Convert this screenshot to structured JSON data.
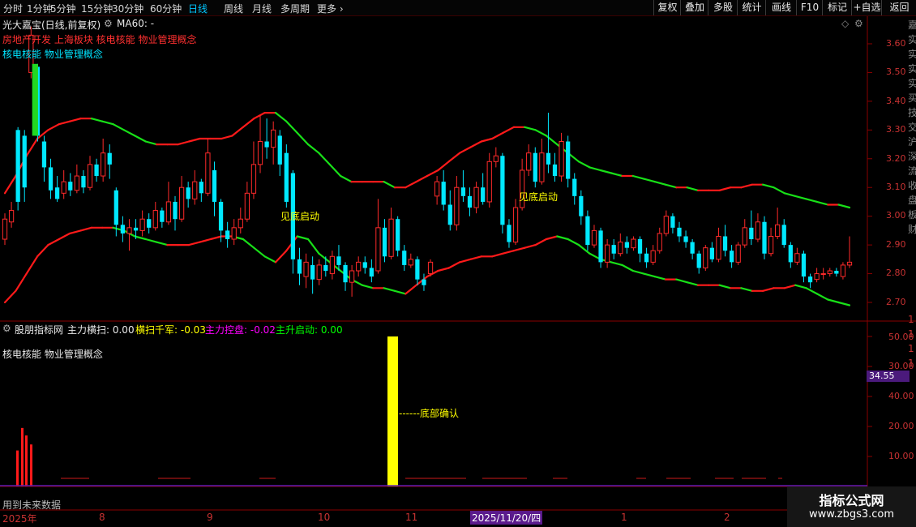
{
  "toolbar": {
    "periods": [
      {
        "label": "分时",
        "active": false
      },
      {
        "label": "1分钟",
        "active": false
      },
      {
        "label": "5分钟",
        "active": false
      },
      {
        "label": "15分钟",
        "active": false
      },
      {
        "label": "30分钟",
        "active": false
      },
      {
        "label": "60分钟",
        "active": false
      },
      {
        "label": "日线",
        "active": true
      },
      {
        "label": "周线",
        "active": false
      },
      {
        "label": "月线",
        "active": false
      },
      {
        "label": "多周期",
        "active": false
      },
      {
        "label": "更多",
        "active": false
      }
    ],
    "right_buttons": [
      "复权",
      "叠加",
      "多股",
      "统计",
      "画线",
      "F10",
      "标记",
      "+自选",
      "返回"
    ]
  },
  "price_panel": {
    "stock_name": "光大嘉宝(日线,前复权)",
    "ma_label": "MA60: -",
    "concept_line1": "房地产开发 上海板块 核电核能 物业管理概念",
    "concept_line2": "核电核能 物业管理概念",
    "annotation": "见底启动",
    "price_ticks": [
      "3.60",
      "3.50",
      "3.40",
      "3.30",
      "3.20",
      "3.10",
      "3.00",
      "2.90",
      "2.80",
      "2.70"
    ]
  },
  "indicator_panel": {
    "name": "股朋指标网",
    "fields": [
      {
        "label": "主力横扫: 0.00",
        "color": "#e8e8e8"
      },
      {
        "label": "横扫千军: -0.03",
        "color": "#ffff00"
      },
      {
        "label": "主力控盘: -0.02",
        "color": "#ff00ff"
      },
      {
        "label": "主升启动: 0.00",
        "color": "#00ff00"
      }
    ],
    "concept": "核电核能 物业管理概念",
    "annotation": "------底部确认",
    "ticks": [
      "50.00",
      "40.00",
      "30.00",
      "20.00",
      "10.00"
    ],
    "ticks_truncated": [
      "1",
      "1",
      "1",
      "1"
    ],
    "current_value": "34.55",
    "footer_note": "用到未来数据"
  },
  "date_axis": {
    "labels": [
      "2025年",
      "8",
      "9",
      "10",
      "11",
      "2025/11/20/四",
      "1",
      "2"
    ]
  },
  "right_edge_fragments": [
    "嘉",
    "实",
    "实",
    "实",
    "实",
    "买",
    "技",
    "交",
    "沪",
    "深",
    "流",
    "收",
    "盘",
    "板",
    "财",
    "1",
    "1",
    "1",
    "1"
  ],
  "watermark": {
    "title": "指标公式网",
    "url": "www.zbgs3.com"
  },
  "chart_data": {
    "type": "candlestick",
    "title": "光大嘉宝(日线,前复权)",
    "ylim": [
      2.66,
      3.66
    ],
    "yticks": [
      3.6,
      3.5,
      3.4,
      3.3,
      3.2,
      3.1,
      3.0,
      2.9,
      2.8,
      2.7
    ],
    "upper_band": [
      3.08,
      3.14,
      3.21,
      3.27,
      3.3,
      3.32,
      3.33,
      3.34,
      3.34,
      3.33,
      3.32,
      3.3,
      3.28,
      3.26,
      3.25,
      3.25,
      3.25,
      3.26,
      3.27,
      3.27,
      3.27,
      3.28,
      3.31,
      3.34,
      3.36,
      3.36,
      3.33,
      3.29,
      3.25,
      3.22,
      3.18,
      3.14,
      3.12,
      3.12,
      3.12,
      3.12,
      3.1,
      3.1,
      3.12,
      3.14,
      3.16,
      3.19,
      3.22,
      3.24,
      3.26,
      3.27,
      3.29,
      3.31,
      3.31,
      3.3,
      3.28,
      3.25,
      3.22,
      3.19,
      3.17,
      3.16,
      3.15,
      3.14,
      3.14,
      3.13,
      3.12,
      3.11,
      3.1,
      3.1,
      3.09,
      3.09,
      3.09,
      3.1,
      3.1,
      3.11,
      3.11,
      3.1,
      3.08,
      3.07,
      3.06,
      3.05,
      3.04,
      3.04,
      3.03
    ],
    "lower_band": [
      2.7,
      2.74,
      2.8,
      2.86,
      2.9,
      2.92,
      2.94,
      2.95,
      2.96,
      2.96,
      2.96,
      2.95,
      2.93,
      2.92,
      2.91,
      2.9,
      2.9,
      2.9,
      2.91,
      2.92,
      2.93,
      2.93,
      2.92,
      2.89,
      2.86,
      2.84,
      2.88,
      2.93,
      2.92,
      2.87,
      2.84,
      2.81,
      2.78,
      2.76,
      2.75,
      2.75,
      2.74,
      2.73,
      2.76,
      2.79,
      2.81,
      2.82,
      2.84,
      2.85,
      2.86,
      2.86,
      2.87,
      2.88,
      2.89,
      2.9,
      2.92,
      2.93,
      2.92,
      2.9,
      2.87,
      2.85,
      2.84,
      2.83,
      2.81,
      2.8,
      2.79,
      2.78,
      2.78,
      2.77,
      2.76,
      2.76,
      2.76,
      2.75,
      2.75,
      2.74,
      2.74,
      2.75,
      2.75,
      2.76,
      2.75,
      2.73,
      2.71,
      2.7,
      2.69
    ],
    "candles": [
      {
        "o": 2.92,
        "c": 2.99,
        "h": 3.01,
        "l": 2.9
      },
      {
        "o": 2.98,
        "c": 3.02,
        "h": 3.05,
        "l": 2.96
      },
      {
        "o": 3.3,
        "c": 3.05,
        "h": 3.31,
        "l": 3.02
      },
      {
        "o": 3.28,
        "c": 3.1,
        "h": 3.3,
        "l": 3.05
      },
      {
        "o": 3.5,
        "c": 3.63,
        "h": 3.66,
        "l": 3.48
      },
      {
        "o": 3.52,
        "c": 3.28,
        "h": 3.53,
        "l": 3.26
      },
      {
        "o": 3.26,
        "c": 3.17,
        "h": 3.28,
        "l": 3.12
      },
      {
        "o": 3.17,
        "c": 3.09,
        "h": 3.2,
        "l": 3.06
      },
      {
        "o": 3.1,
        "c": 3.06,
        "h": 3.14,
        "l": 3.05
      },
      {
        "o": 3.08,
        "c": 3.12,
        "h": 3.16,
        "l": 3.06
      },
      {
        "o": 3.12,
        "c": 3.09,
        "h": 3.15,
        "l": 3.07
      },
      {
        "o": 3.09,
        "c": 3.14,
        "h": 3.18,
        "l": 3.08
      },
      {
        "o": 3.14,
        "c": 3.1,
        "h": 3.16,
        "l": 3.08
      },
      {
        "o": 3.1,
        "c": 3.18,
        "h": 3.21,
        "l": 3.09
      },
      {
        "o": 3.18,
        "c": 3.14,
        "h": 3.2,
        "l": 3.12
      },
      {
        "o": 3.14,
        "c": 3.22,
        "h": 3.27,
        "l": 3.12
      },
      {
        "o": 3.22,
        "c": 3.18,
        "h": 3.25,
        "l": 3.13
      },
      {
        "o": 3.09,
        "c": 2.97,
        "h": 3.1,
        "l": 2.93
      },
      {
        "o": 2.97,
        "c": 2.94,
        "h": 3.0,
        "l": 2.91
      },
      {
        "o": 2.94,
        "c": 2.96,
        "h": 2.99,
        "l": 2.88
      },
      {
        "o": 2.96,
        "c": 2.95,
        "h": 2.99,
        "l": 2.92
      },
      {
        "o": 2.95,
        "c": 2.99,
        "h": 3.02,
        "l": 2.93
      },
      {
        "o": 2.99,
        "c": 2.96,
        "h": 3.01,
        "l": 2.94
      },
      {
        "o": 2.96,
        "c": 3.02,
        "h": 3.05,
        "l": 2.95
      },
      {
        "o": 3.02,
        "c": 2.98,
        "h": 3.03,
        "l": 2.96
      },
      {
        "o": 2.98,
        "c": 3.05,
        "h": 3.12,
        "l": 2.97
      },
      {
        "o": 3.05,
        "c": 2.99,
        "h": 3.07,
        "l": 2.95
      },
      {
        "o": 2.99,
        "c": 3.1,
        "h": 3.14,
        "l": 2.98
      },
      {
        "o": 3.1,
        "c": 3.06,
        "h": 3.12,
        "l": 3.03
      },
      {
        "o": 3.06,
        "c": 3.12,
        "h": 3.16,
        "l": 3.04
      },
      {
        "o": 3.12,
        "c": 3.08,
        "h": 3.13,
        "l": 3.05
      },
      {
        "o": 3.08,
        "c": 3.22,
        "h": 3.27,
        "l": 3.07
      },
      {
        "o": 3.16,
        "c": 3.05,
        "h": 3.19,
        "l": 3.0
      },
      {
        "o": 3.05,
        "c": 2.95,
        "h": 3.06,
        "l": 2.91
      },
      {
        "o": 2.95,
        "c": 2.92,
        "h": 2.98,
        "l": 2.89
      },
      {
        "o": 2.92,
        "c": 2.96,
        "h": 2.99,
        "l": 2.9
      },
      {
        "o": 2.96,
        "c": 2.99,
        "h": 3.03,
        "l": 2.94
      },
      {
        "o": 2.99,
        "c": 3.08,
        "h": 3.12,
        "l": 2.98
      },
      {
        "o": 3.08,
        "c": 3.18,
        "h": 3.26,
        "l": 3.06
      },
      {
        "o": 3.18,
        "c": 3.26,
        "h": 3.35,
        "l": 3.15
      },
      {
        "o": 3.26,
        "c": 3.24,
        "h": 3.34,
        "l": 3.2
      },
      {
        "o": 3.24,
        "c": 3.3,
        "h": 3.33,
        "l": 3.18
      },
      {
        "o": 3.28,
        "c": 3.18,
        "h": 3.3,
        "l": 3.14
      },
      {
        "o": 3.22,
        "c": 3.05,
        "h": 3.25,
        "l": 3.03
      },
      {
        "o": 3.15,
        "c": 2.85,
        "h": 3.16,
        "l": 2.8
      },
      {
        "o": 2.85,
        "c": 2.8,
        "h": 2.89,
        "l": 2.76
      },
      {
        "o": 2.79,
        "c": 2.84,
        "h": 2.87,
        "l": 2.75
      },
      {
        "o": 2.83,
        "c": 2.78,
        "h": 2.86,
        "l": 2.73
      },
      {
        "o": 2.78,
        "c": 2.83,
        "h": 2.85,
        "l": 2.76
      },
      {
        "o": 2.83,
        "c": 2.81,
        "h": 2.86,
        "l": 2.79
      },
      {
        "o": 2.8,
        "c": 2.86,
        "h": 2.88,
        "l": 2.78
      },
      {
        "o": 2.86,
        "c": 2.83,
        "h": 2.9,
        "l": 2.81
      },
      {
        "o": 2.83,
        "c": 2.77,
        "h": 2.84,
        "l": 2.74
      },
      {
        "o": 2.77,
        "c": 2.81,
        "h": 2.83,
        "l": 2.72
      },
      {
        "o": 2.81,
        "c": 2.84,
        "h": 2.86,
        "l": 2.79
      },
      {
        "o": 2.84,
        "c": 2.82,
        "h": 2.86,
        "l": 2.8
      },
      {
        "o": 2.82,
        "c": 2.79,
        "h": 2.85,
        "l": 2.77
      },
      {
        "o": 2.81,
        "c": 2.96,
        "h": 3.06,
        "l": 2.8
      },
      {
        "o": 2.96,
        "c": 2.86,
        "h": 2.99,
        "l": 2.84
      },
      {
        "o": 2.86,
        "c": 2.99,
        "h": 3.03,
        "l": 2.85
      },
      {
        "o": 2.99,
        "c": 2.88,
        "h": 3.0,
        "l": 2.86
      },
      {
        "o": 2.88,
        "c": 2.83,
        "h": 2.9,
        "l": 2.81
      },
      {
        "o": 2.83,
        "c": 2.85,
        "h": 2.87,
        "l": 2.82
      },
      {
        "o": 2.85,
        "c": 2.78,
        "h": 2.86,
        "l": 2.76
      },
      {
        "o": 2.78,
        "c": 2.76,
        "h": 2.8,
        "l": 2.74
      },
      {
        "o": 2.8,
        "c": 2.84,
        "h": 2.85,
        "l": 2.79
      },
      {
        "o": 3.07,
        "c": 3.12,
        "h": 3.14,
        "l": 3.04
      },
      {
        "o": 3.12,
        "c": 3.04,
        "h": 3.16,
        "l": 3.02
      },
      {
        "o": 3.04,
        "c": 2.97,
        "h": 3.09,
        "l": 2.95
      },
      {
        "o": 2.97,
        "c": 3.1,
        "h": 3.14,
        "l": 2.95
      },
      {
        "o": 3.1,
        "c": 3.07,
        "h": 3.16,
        "l": 3.05
      },
      {
        "o": 3.07,
        "c": 3.03,
        "h": 3.1,
        "l": 3.0
      },
      {
        "o": 3.03,
        "c": 3.1,
        "h": 3.12,
        "l": 3.01
      },
      {
        "o": 3.1,
        "c": 3.05,
        "h": 3.15,
        "l": 3.04
      },
      {
        "o": 3.05,
        "c": 3.19,
        "h": 3.22,
        "l": 3.03
      },
      {
        "o": 3.19,
        "c": 3.21,
        "h": 3.24,
        "l": 3.17
      },
      {
        "o": 3.21,
        "c": 2.97,
        "h": 3.22,
        "l": 2.94
      },
      {
        "o": 2.97,
        "c": 2.91,
        "h": 2.99,
        "l": 2.89
      },
      {
        "o": 2.91,
        "c": 3.03,
        "h": 3.06,
        "l": 2.9
      },
      {
        "o": 3.03,
        "c": 3.16,
        "h": 3.2,
        "l": 3.02
      },
      {
        "o": 3.16,
        "c": 3.22,
        "h": 3.25,
        "l": 3.14
      },
      {
        "o": 3.22,
        "c": 3.12,
        "h": 3.24,
        "l": 3.1
      },
      {
        "o": 3.12,
        "c": 3.22,
        "h": 3.27,
        "l": 3.11
      },
      {
        "o": 3.22,
        "c": 3.18,
        "h": 3.36,
        "l": 3.15
      },
      {
        "o": 3.18,
        "c": 3.14,
        "h": 3.22,
        "l": 3.12
      },
      {
        "o": 3.14,
        "c": 3.26,
        "h": 3.29,
        "l": 3.12
      },
      {
        "o": 3.26,
        "c": 3.13,
        "h": 3.28,
        "l": 3.1
      },
      {
        "o": 3.13,
        "c": 3.07,
        "h": 3.15,
        "l": 3.04
      },
      {
        "o": 3.07,
        "c": 3.0,
        "h": 3.09,
        "l": 2.97
      },
      {
        "o": 3.0,
        "c": 2.9,
        "h": 3.02,
        "l": 2.88
      },
      {
        "o": 2.9,
        "c": 2.95,
        "h": 2.97,
        "l": 2.89
      },
      {
        "o": 2.95,
        "c": 2.84,
        "h": 2.96,
        "l": 2.82
      },
      {
        "o": 2.84,
        "c": 2.9,
        "h": 2.92,
        "l": 2.82
      },
      {
        "o": 2.9,
        "c": 2.87,
        "h": 2.92,
        "l": 2.85
      },
      {
        "o": 2.87,
        "c": 2.91,
        "h": 2.94,
        "l": 2.86
      },
      {
        "o": 2.91,
        "c": 2.89,
        "h": 2.93,
        "l": 2.87
      },
      {
        "o": 2.89,
        "c": 2.92,
        "h": 2.93,
        "l": 2.88
      },
      {
        "o": 2.92,
        "c": 2.87,
        "h": 2.93,
        "l": 2.84
      },
      {
        "o": 2.87,
        "c": 2.84,
        "h": 2.89,
        "l": 2.82
      },
      {
        "o": 2.84,
        "c": 2.88,
        "h": 2.9,
        "l": 2.83
      },
      {
        "o": 2.88,
        "c": 2.94,
        "h": 2.96,
        "l": 2.87
      },
      {
        "o": 2.94,
        "c": 3.0,
        "h": 3.02,
        "l": 2.93
      },
      {
        "o": 3.0,
        "c": 2.96,
        "h": 3.01,
        "l": 2.94
      },
      {
        "o": 2.96,
        "c": 2.93,
        "h": 2.98,
        "l": 2.91
      },
      {
        "o": 2.93,
        "c": 2.91,
        "h": 2.95,
        "l": 2.89
      },
      {
        "o": 2.91,
        "c": 2.87,
        "h": 2.92,
        "l": 2.85
      },
      {
        "o": 2.87,
        "c": 2.82,
        "h": 2.88,
        "l": 2.8
      },
      {
        "o": 2.82,
        "c": 2.89,
        "h": 2.9,
        "l": 2.81
      },
      {
        "o": 2.89,
        "c": 2.85,
        "h": 2.91,
        "l": 2.84
      },
      {
        "o": 2.85,
        "c": 2.93,
        "h": 2.96,
        "l": 2.84
      },
      {
        "o": 2.93,
        "c": 2.88,
        "h": 2.97,
        "l": 2.86
      },
      {
        "o": 2.88,
        "c": 2.84,
        "h": 2.9,
        "l": 2.82
      },
      {
        "o": 2.84,
        "c": 2.9,
        "h": 2.91,
        "l": 2.83
      },
      {
        "o": 2.9,
        "c": 2.96,
        "h": 2.99,
        "l": 2.89
      },
      {
        "o": 2.96,
        "c": 2.92,
        "h": 3.02,
        "l": 2.9
      },
      {
        "o": 2.92,
        "c": 2.98,
        "h": 3.01,
        "l": 2.91
      },
      {
        "o": 2.98,
        "c": 2.87,
        "h": 3.0,
        "l": 2.85
      },
      {
        "o": 2.87,
        "c": 2.93,
        "h": 2.96,
        "l": 2.86
      },
      {
        "o": 2.93,
        "c": 2.97,
        "h": 3.03,
        "l": 2.92
      },
      {
        "o": 2.97,
        "c": 2.9,
        "h": 2.99,
        "l": 2.89
      },
      {
        "o": 2.9,
        "c": 2.84,
        "h": 2.91,
        "l": 2.82
      },
      {
        "o": 2.84,
        "c": 2.87,
        "h": 2.89,
        "l": 2.83
      },
      {
        "o": 2.87,
        "c": 2.79,
        "h": 2.88,
        "l": 2.77
      },
      {
        "o": 2.79,
        "c": 2.77,
        "h": 2.8,
        "l": 2.75
      },
      {
        "o": 2.78,
        "c": 2.8,
        "h": 2.82,
        "l": 2.77
      },
      {
        "o": 2.8,
        "c": 2.8,
        "h": 2.82,
        "l": 2.78
      },
      {
        "o": 2.8,
        "c": 2.81,
        "h": 2.82,
        "l": 2.79
      },
      {
        "o": 2.81,
        "c": 2.8,
        "h": 2.82,
        "l": 2.79
      },
      {
        "o": 2.79,
        "c": 2.83,
        "h": 2.84,
        "l": 2.78
      },
      {
        "o": 2.83,
        "c": 2.84,
        "h": 2.93,
        "l": 2.82
      }
    ],
    "indicator_bars": {
      "red_bars": [
        12,
        19.5,
        17,
        14
      ],
      "yellow_bar": 50,
      "ylim": [
        0,
        55
      ],
      "yticks": [
        50,
        40,
        30,
        20,
        10
      ],
      "current_value": 34.55
    }
  }
}
